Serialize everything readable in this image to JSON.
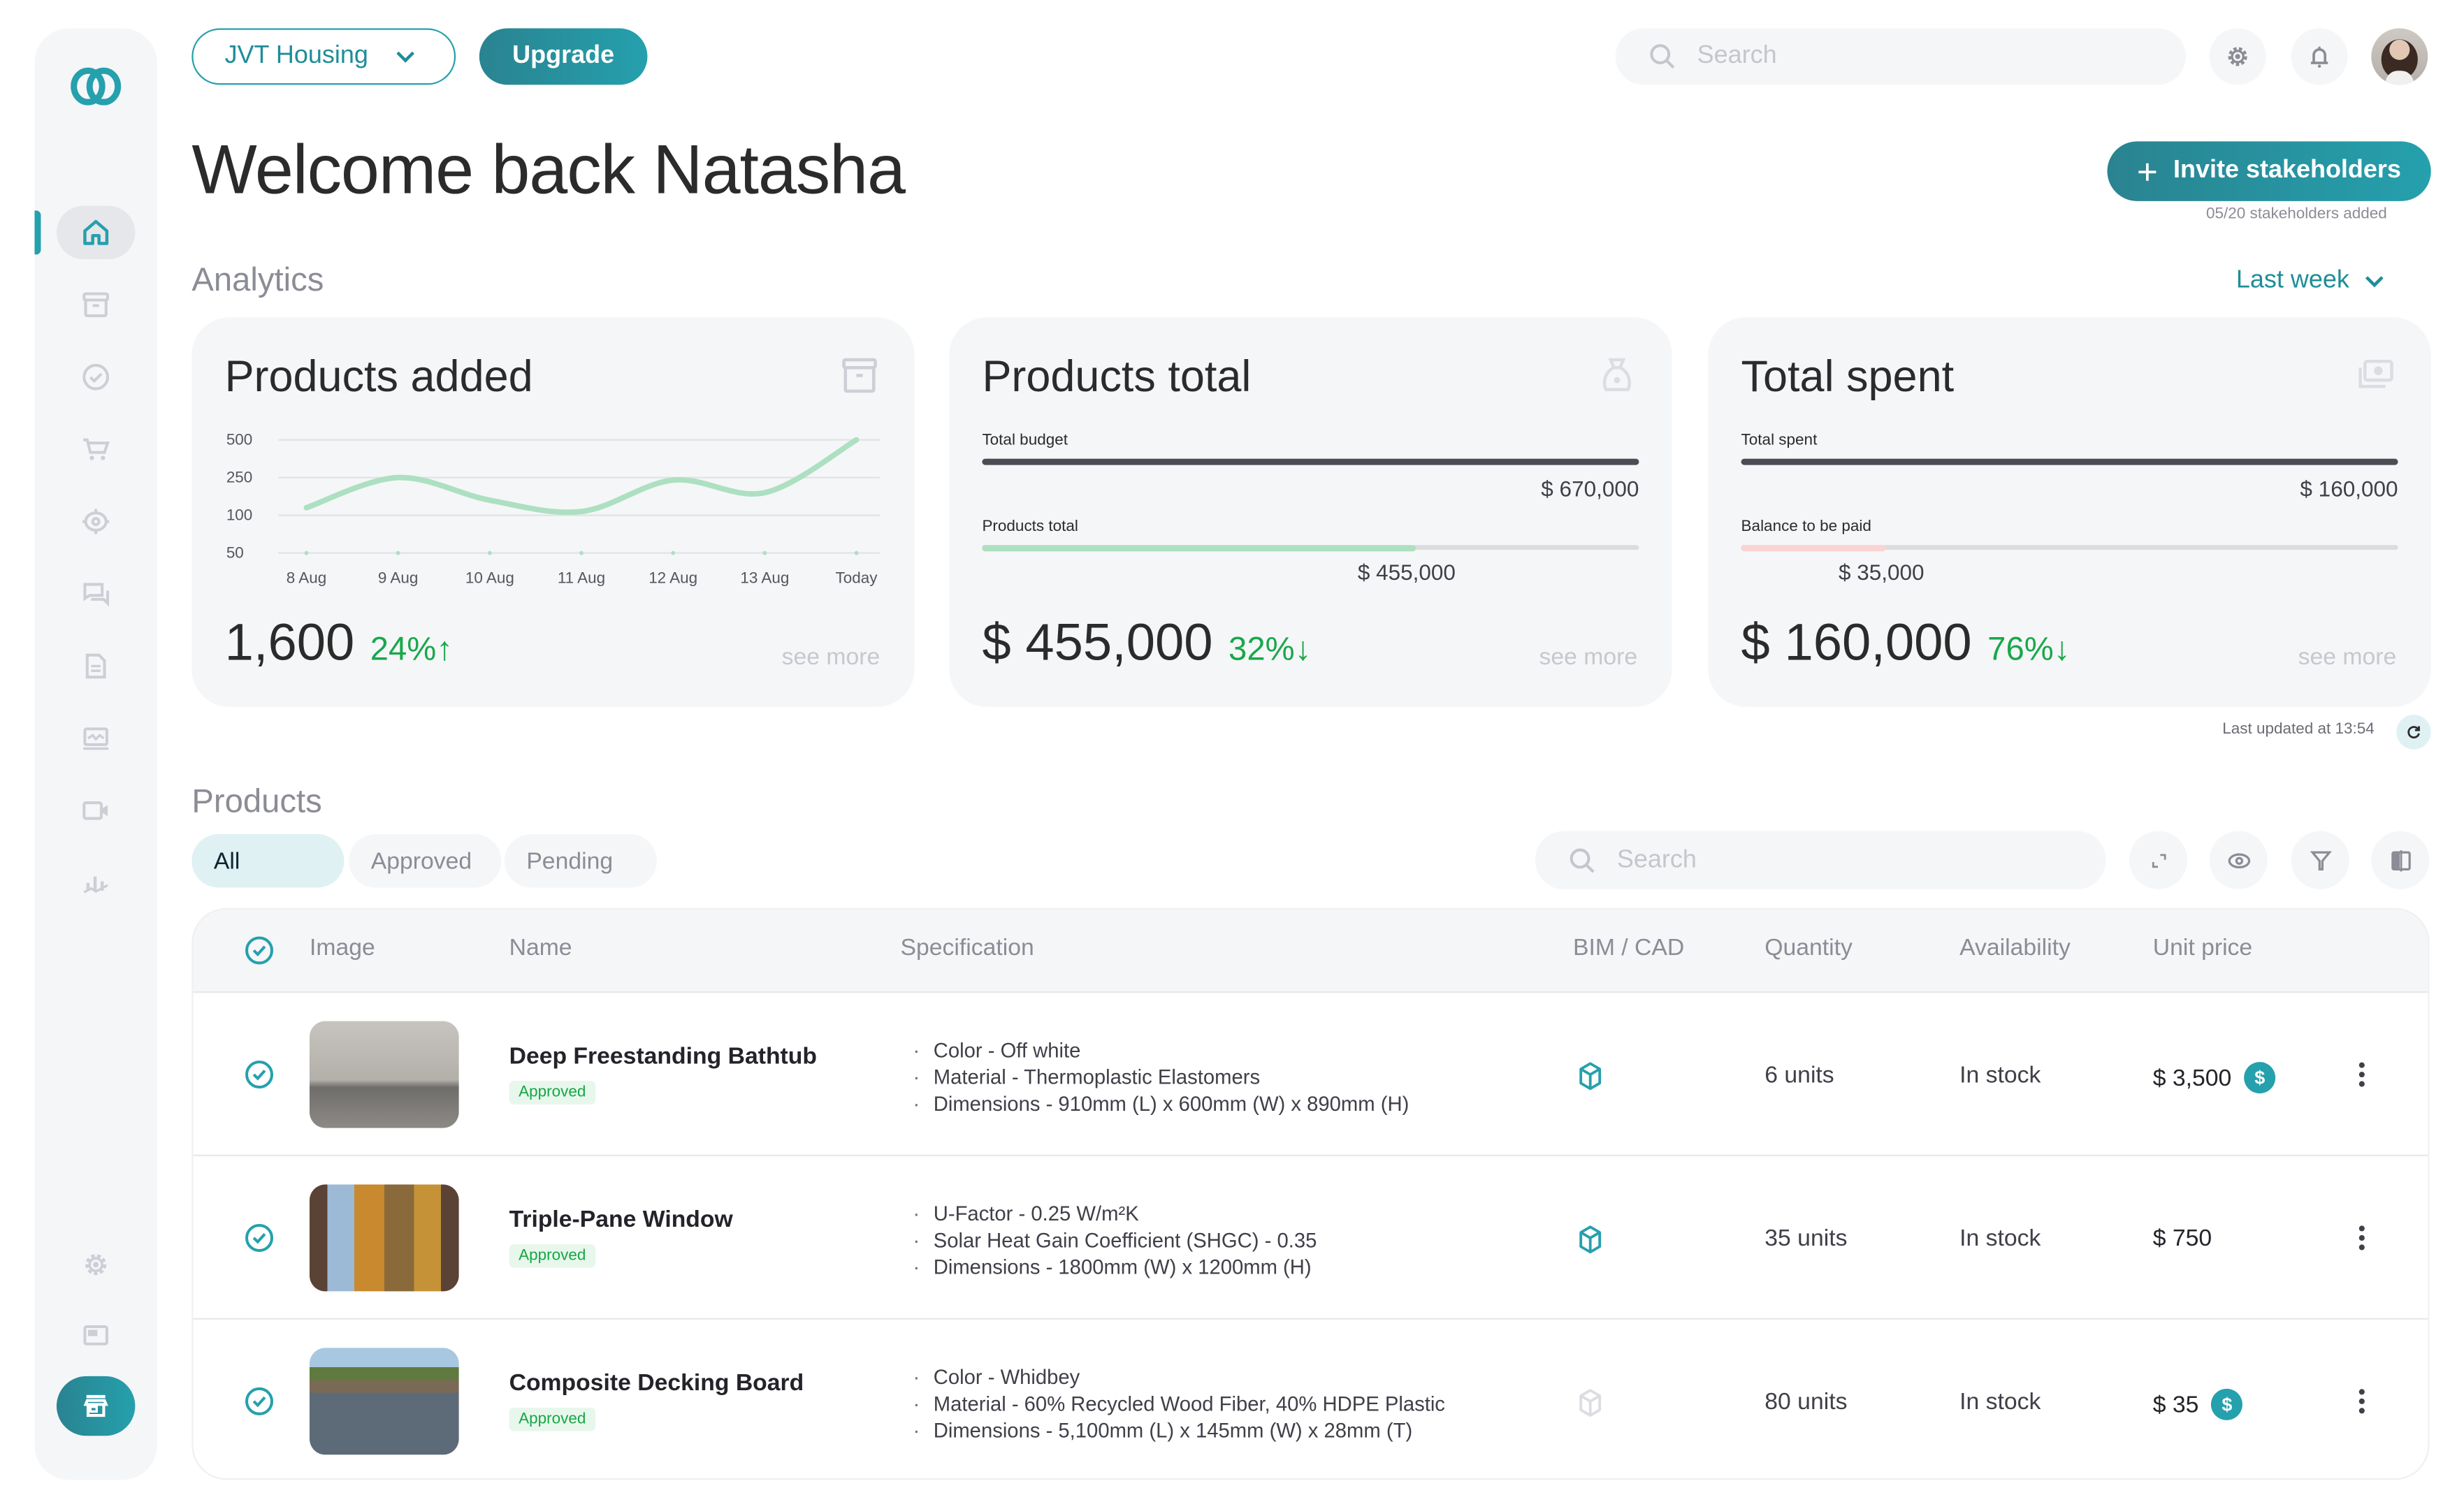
{
  "colors": {
    "accent": "#25a0ad",
    "accent_dark": "#2a8390",
    "positive": "#18a84a",
    "approved_bg": "#e8f7ec",
    "panel_bg": "#f5f6f8",
    "progress_budget": "#4b4c54",
    "progress_products": "#ace0c1",
    "progress_balance": "#fbd3d3",
    "chart_line": "#ace0c1"
  },
  "topbar": {
    "workspace": "JVT Housing",
    "upgrade_label": "Upgrade",
    "search_placeholder": "Search"
  },
  "sidebar": {
    "items": [
      {
        "name": "home",
        "icon": "home-icon",
        "active": true
      },
      {
        "name": "products",
        "icon": "archive-box-icon",
        "active": false
      },
      {
        "name": "approvals",
        "icon": "check-circle-icon",
        "active": false
      },
      {
        "name": "orders",
        "icon": "cart-icon",
        "active": false
      },
      {
        "name": "tracking",
        "icon": "target-icon",
        "active": false
      },
      {
        "name": "messages",
        "icon": "chat-icon",
        "active": false
      },
      {
        "name": "documents",
        "icon": "document-icon",
        "active": false
      },
      {
        "name": "reports",
        "icon": "monitor-chart-icon",
        "active": false
      },
      {
        "name": "meetings",
        "icon": "video-icon",
        "active": false
      },
      {
        "name": "analytics",
        "icon": "bar-trend-icon",
        "active": false
      }
    ],
    "bottom": [
      {
        "name": "settings",
        "icon": "gear-icon"
      },
      {
        "name": "layout",
        "icon": "window-icon"
      },
      {
        "name": "store",
        "icon": "store-icon"
      }
    ]
  },
  "header": {
    "title": "Welcome back Natasha",
    "invite_label": "Invite stakeholders",
    "stakeholders_count": "05/20 stakeholders added"
  },
  "analytics": {
    "title": "Analytics",
    "period": "Last week",
    "last_updated": "Last updated at 13:54",
    "cards": [
      {
        "title": "Products added",
        "icon": "archive-box-icon",
        "value": "1,600",
        "delta": "24%",
        "delta_direction": "↑",
        "see_more": "see more"
      },
      {
        "title": "Products total",
        "icon": "money-bag-icon",
        "value": "$ 455,000",
        "delta": "32%",
        "delta_direction": "↓",
        "see_more": "see more",
        "bars": [
          {
            "label": "Total budget",
            "amount": "$ 670,000",
            "fraction": 1.0,
            "color": "#4b4c54"
          },
          {
            "label": "Products total",
            "amount": "$ 455,000",
            "fraction": 0.66,
            "color": "#ace0c1"
          }
        ]
      },
      {
        "title": "Total spent",
        "icon": "cash-icon",
        "value": "$ 160,000",
        "delta": "76%",
        "delta_direction": "↓",
        "see_more": "see more",
        "bars": [
          {
            "label": "Total spent",
            "amount": "$ 160,000",
            "fraction": 1.0,
            "color": "#4b4c54"
          },
          {
            "label": "Balance to be paid",
            "amount": "$ 35,000",
            "fraction": 0.22,
            "color": "#fbd3d3"
          }
        ]
      }
    ]
  },
  "chart_data": {
    "type": "line",
    "title": "Products added",
    "categories": [
      "8 Aug",
      "9 Aug",
      "10 Aug",
      "11 Aug",
      "12 Aug",
      "13 Aug",
      "Today"
    ],
    "yticks": [
      50,
      100,
      250,
      500
    ],
    "series": [
      {
        "name": "Products added",
        "values": [
          130,
          250,
          160,
          115,
          240,
          190,
          500
        ]
      }
    ],
    "xlabel": "",
    "ylabel": "",
    "grid": true,
    "legend": "none"
  },
  "products": {
    "title": "Products",
    "tabs": [
      {
        "label": "All",
        "active": true
      },
      {
        "label": "Approved",
        "active": false
      },
      {
        "label": "Pending",
        "active": false
      }
    ],
    "search_placeholder": "Search",
    "toolbar_icons": [
      "expand-icon",
      "eye-icon",
      "filter-icon",
      "columns-icon"
    ],
    "columns": [
      "Image",
      "Name",
      "Specification",
      "BIM / CAD",
      "Quantity",
      "Availability",
      "Unit price"
    ],
    "rows": [
      {
        "name": "Deep Freestanding Bathtub",
        "status": "Approved",
        "image": "bathtub",
        "specs": [
          "Color - Off white",
          "Material - Thermoplastic Elastomers",
          "Dimensions - 910mm (L) x 600mm (W) x 890mm (H)"
        ],
        "bim_available": true,
        "quantity": "6 units",
        "availability": "In stock",
        "price": "$ 3,500",
        "price_badge": true
      },
      {
        "name": "Triple-Pane Window",
        "status": "Approved",
        "image": "window",
        "specs": [
          "U-Factor - 0.25 W/m²K",
          "Solar Heat Gain Coefficient (SHGC) - 0.35",
          "Dimensions - 1800mm (W) x 1200mm (H)"
        ],
        "bim_available": true,
        "quantity": "35 units",
        "availability": "In stock",
        "price": "$ 750",
        "price_badge": false
      },
      {
        "name": "Composite Decking Board",
        "status": "Approved",
        "image": "decking",
        "specs": [
          "Color - Whidbey",
          "Material - 60% Recycled Wood Fiber, 40% HDPE Plastic",
          "Dimensions - 5,100mm (L) x 145mm (W) x 28mm (T)"
        ],
        "bim_available": false,
        "quantity": "80 units",
        "availability": "In stock",
        "price": "$ 35",
        "price_badge": true
      }
    ],
    "coin_symbol": "$"
  }
}
